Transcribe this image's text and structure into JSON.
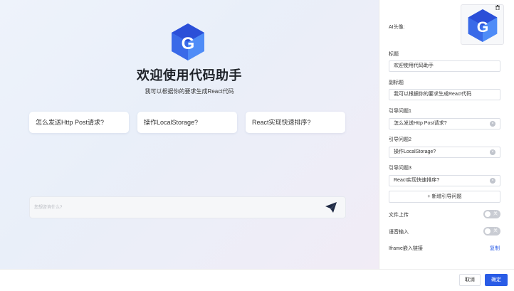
{
  "preview": {
    "title": "欢迎使用代码助手",
    "subtitle": "我可以根据你的要求生成React代码",
    "suggestions": [
      "怎么发送Http Post请求?",
      "操作LocalStorage?",
      "React实现快速排序?"
    ],
    "input_placeholder": "您想咨询什么?",
    "send_icon": "send-icon",
    "logo_icon": "g-logo-icon"
  },
  "panel": {
    "avatar_label": "AI头像:",
    "avatar_icon": "g-logo-icon",
    "delete_icon": "trash-icon",
    "title_label": "标题",
    "title_value": "欢迎使用代码助手",
    "subtitle_label": "副标题",
    "subtitle_value": "我可以根据你的要求生成React代码",
    "questions": [
      {
        "label": "引导问题1",
        "value": "怎么发送Http Post请求?"
      },
      {
        "label": "引导问题2",
        "value": "操作LocalStorage?"
      },
      {
        "label": "引导问题3",
        "value": "React实现快速排序?"
      }
    ],
    "add_question": "+  新增引导问题",
    "file_upload_label": "文件上传",
    "file_upload_state": "关",
    "voice_input_label": "语音输入",
    "voice_input_state": "关",
    "iframe_label": "Iframe嵌入链接",
    "copy_label": "复制"
  },
  "footer": {
    "cancel": "取消",
    "confirm": "确定"
  },
  "colors": {
    "accent": "#2a5ce6",
    "logo_dark": "#2b4fd8",
    "logo_light": "#4f8cf7"
  }
}
